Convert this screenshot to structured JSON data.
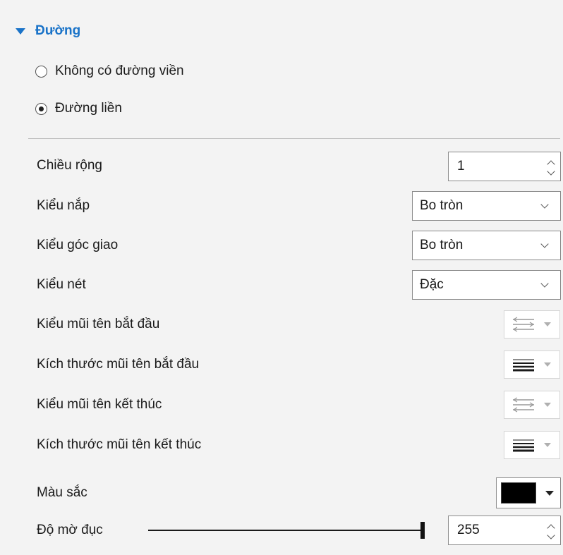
{
  "section": {
    "title": "Đường",
    "icon": "triangle-down-icon",
    "accent": "#1a73c8"
  },
  "border_options": [
    {
      "label": "Không có đường viền",
      "selected": false
    },
    {
      "label": "Đường liền",
      "selected": true
    }
  ],
  "properties": {
    "width": {
      "label": "Chiều rộng",
      "value": "1"
    },
    "cap_type": {
      "label": "Kiểu nắp",
      "value": "Bo tròn"
    },
    "join_type": {
      "label": "Kiểu góc giao",
      "value": "Bo tròn"
    },
    "dash_type": {
      "label": "Kiểu nét",
      "value": "Đặc"
    },
    "begin_arrow_type": {
      "label": "Kiểu mũi tên bắt đầu",
      "icon": "arrow-style-icon"
    },
    "begin_arrow_size": {
      "label": "Kích thước mũi tên bắt đầu",
      "icon": "arrow-size-icon"
    },
    "end_arrow_type": {
      "label": "Kiểu mũi tên kết thúc",
      "icon": "arrow-style-icon"
    },
    "end_arrow_size": {
      "label": "Kích thước mũi tên kết thúc",
      "icon": "arrow-size-icon"
    },
    "color": {
      "label": "Màu sắc",
      "value": "#000000"
    },
    "opacity": {
      "label": "Độ mờ đục",
      "value": "255",
      "fraction": 1.0
    }
  }
}
